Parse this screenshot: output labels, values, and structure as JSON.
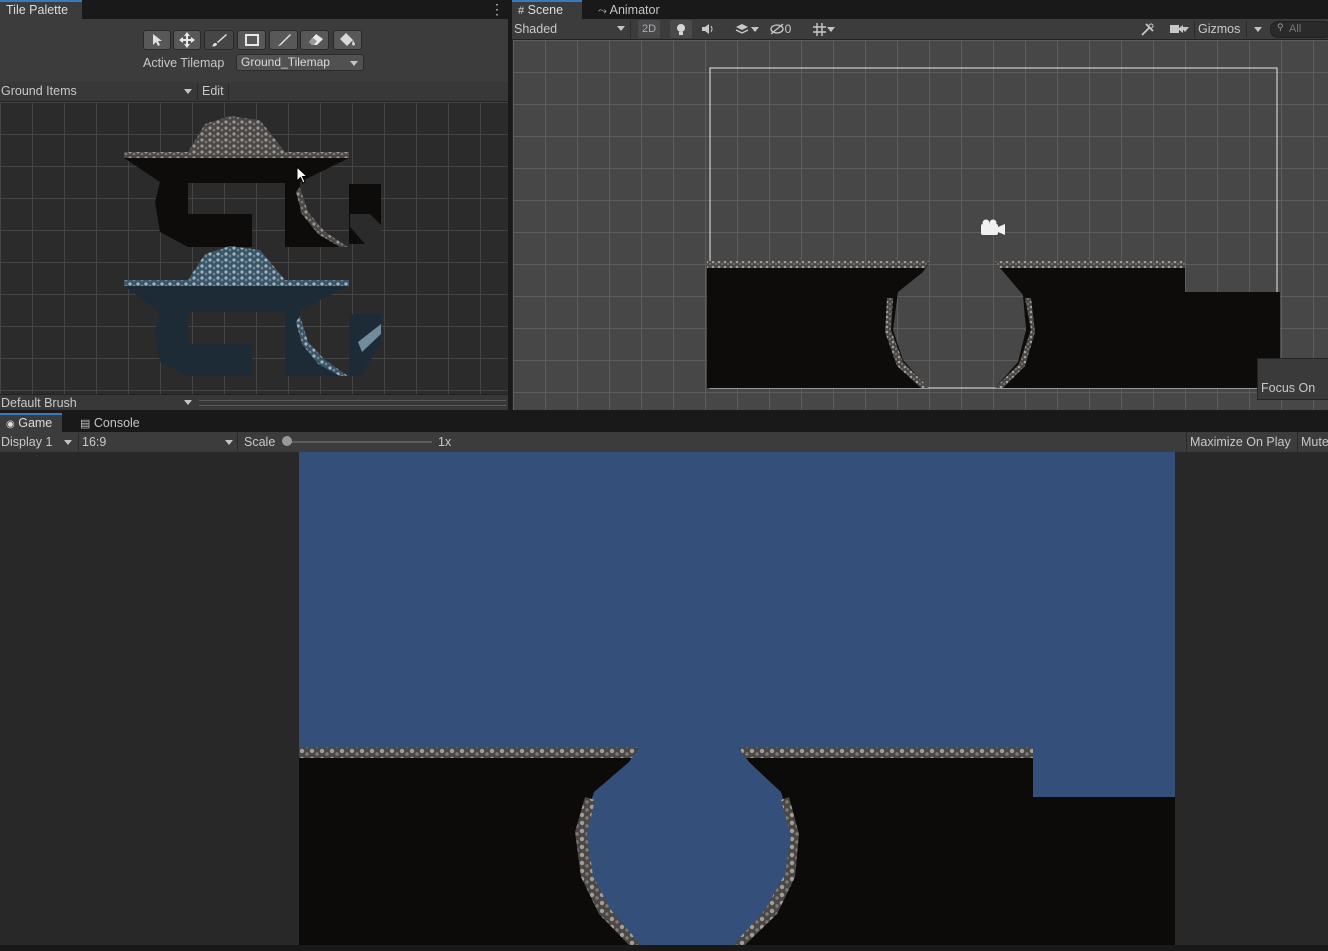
{
  "tile_palette": {
    "tab_label": "Tile Palette",
    "active_tilemap_label": "Active Tilemap",
    "active_tilemap_value": "Ground_Tilemap",
    "palette_dropdown": "Ground Items",
    "edit_label": "Edit",
    "brush_dropdown": "Default Brush",
    "tools": [
      "select-icon",
      "move-icon",
      "brush-icon",
      "box-fill-icon",
      "picker-icon",
      "eraser-icon",
      "fill-bucket-icon"
    ],
    "active_tool": "brush-icon"
  },
  "scene": {
    "tabs": [
      {
        "label": "Scene",
        "icon": "grid-icon"
      },
      {
        "label": "Animator",
        "icon": "animator-icon"
      }
    ],
    "shading_dropdown": "Shaded",
    "toggle_2d": "2D",
    "hidden_count": "0",
    "gizmos_label": "Gizmos",
    "search_placeholder": "All",
    "focus_on_label": "Focus On"
  },
  "game": {
    "tabs": [
      {
        "label": "Game",
        "icon": "gamepad-icon"
      },
      {
        "label": "Console",
        "icon": "console-icon"
      }
    ],
    "display_dropdown": "Display 1",
    "aspect_dropdown": "16:9",
    "scale_label": "Scale",
    "scale_value": "1x",
    "scale_level": 0.0,
    "maximize_label": "Maximize On Play",
    "mute_label": "Mute"
  },
  "colors": {
    "sky": "#334f7a",
    "ground": "#0d0b0a",
    "rock": "#7a7a78",
    "ice": "#20303f",
    "ice_edge": "#8aa3b4",
    "tab_accent": "#3a79bb"
  }
}
